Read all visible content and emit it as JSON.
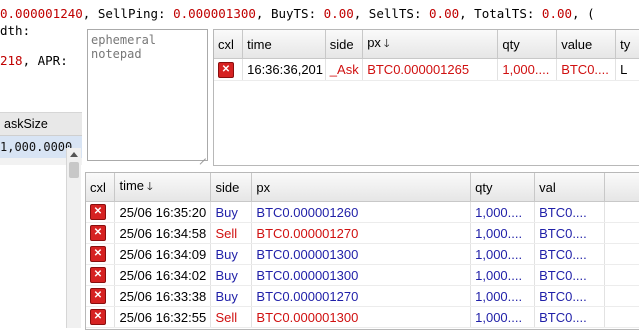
{
  "status_line": {
    "segments": [
      {
        "text": " ",
        "red": false
      },
      {
        "text": "0.000001240",
        "red": true
      },
      {
        "text": ", SellPing: ",
        "red": false
      },
      {
        "text": "0.000001300",
        "red": true
      },
      {
        "text": ", BuyTS: ",
        "red": false
      },
      {
        "text": "0.00",
        "red": true
      },
      {
        "text": ", SellTS: ",
        "red": false
      },
      {
        "text": "0.00",
        "red": true
      },
      {
        "text": ", TotalTS: ",
        "red": false
      },
      {
        "text": "0.00",
        "red": true
      },
      {
        "text": ", (",
        "red": false
      }
    ]
  },
  "left_panel": {
    "line1": "dth:",
    "line2_red": "218",
    "line2_rest": ", APR:",
    "asksize_header": "askSize",
    "asksize_value": "1,000.0000"
  },
  "notepad": {
    "placeholder": "ephemeral\nnotepad",
    "value": ""
  },
  "open_orders": {
    "columns": [
      "cxl",
      "time",
      "side",
      "px",
      "qty",
      "value",
      "ty"
    ],
    "sorted_column": "px",
    "rows": [
      {
        "time": "16:36:36,201",
        "side": "_Ask",
        "px": "BTC0.000001265",
        "qty": "1,000....",
        "value": "BTC0....",
        "type": "L"
      }
    ]
  },
  "history": {
    "columns": [
      "cxl",
      "time",
      "side",
      "px",
      "qty",
      "val"
    ],
    "sorted_column": "time",
    "rows": [
      {
        "time": "25/06 16:35:20",
        "side": "Buy",
        "px": "BTC0.000001260",
        "qty": "1,000....",
        "val": "BTC0...."
      },
      {
        "time": "25/06 16:34:58",
        "side": "Sell",
        "px": "BTC0.000001270",
        "qty": "1,000....",
        "val": "BTC0...."
      },
      {
        "time": "25/06 16:34:09",
        "side": "Buy",
        "px": "BTC0.000001300",
        "qty": "1,000....",
        "val": "BTC0...."
      },
      {
        "time": "25/06 16:34:02",
        "side": "Buy",
        "px": "BTC0.000001300",
        "qty": "1,000....",
        "val": "BTC0...."
      },
      {
        "time": "25/06 16:33:38",
        "side": "Buy",
        "px": "BTC0.000001270",
        "qty": "1,000....",
        "val": "BTC0...."
      },
      {
        "time": "25/06 16:32:55",
        "side": "Sell",
        "px": "BTC0.000001300",
        "qty": "1,000....",
        "val": "BTC0...."
      }
    ]
  },
  "colors": {
    "buy": "#1f1fa8",
    "sell": "#d01010",
    "value_red": "#c00000",
    "cancel_button": "#d62222"
  },
  "icons": {
    "cancel": "close-icon",
    "sort_down": "arrow-down-icon"
  }
}
